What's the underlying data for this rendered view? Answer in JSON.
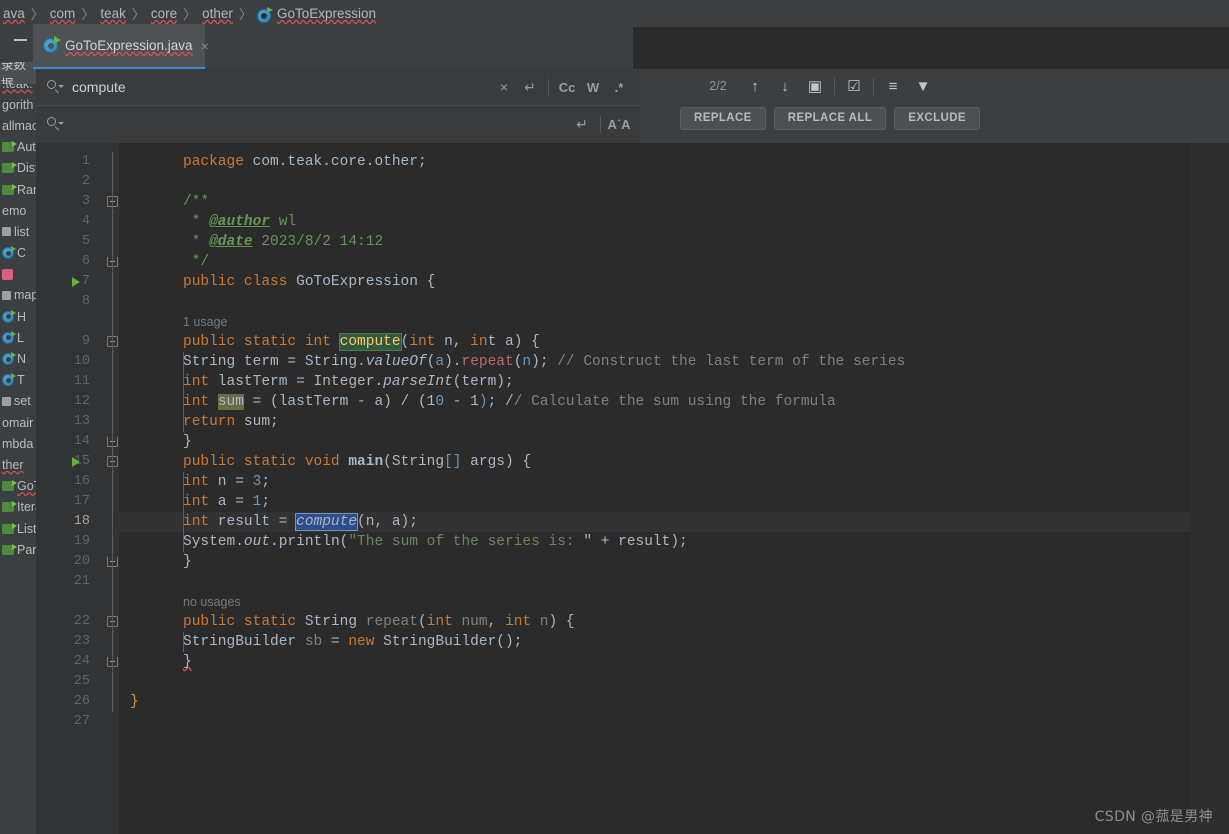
{
  "breadcrumb": {
    "items": [
      "ava",
      "com",
      "teak",
      "core",
      "other"
    ],
    "current_file": "GoToExpression",
    "sep": "〉"
  },
  "window": {
    "minimize_label": "—"
  },
  "tool_tab": {
    "label": "录数据"
  },
  "editor_tab": {
    "label": "GoToExpression.java",
    "close": "×"
  },
  "find": {
    "search_value": "compute",
    "replace_placeholder": "",
    "match_count": "2/2",
    "close_label": "×",
    "newline_label": "↵",
    "match_case": "Cc",
    "words": "W",
    "regex": ".*",
    "preserve_case": "A˙A",
    "prev_label": "↑",
    "next_label": "↓",
    "select_all_label": "▣",
    "in_comments_label": "☑",
    "scope_label": "≡",
    "filter_label": "▼",
    "replace": "REPLACE",
    "replace_all": "REPLACE ALL",
    "exclude": "EXCLUDE"
  },
  "sidebar": {
    "items": [
      {
        "label": ".teak.",
        "icon": "none",
        "squiggle": true
      },
      {
        "label": "gorith",
        "icon": "none",
        "squiggle": false
      },
      {
        "label": "allmac",
        "icon": "none",
        "squiggle": false
      },
      {
        "label": "Autc",
        "icon": "folder-icon",
        "squiggle": false
      },
      {
        "label": "Disti",
        "icon": "folder-icon",
        "squiggle": false
      },
      {
        "label": "Ran",
        "icon": "folder-icon",
        "squiggle": false
      },
      {
        "label": "emo",
        "icon": "none",
        "squiggle": false
      },
      {
        "label": "list",
        "icon": "package-icon",
        "squiggle": false
      },
      {
        "label": "C",
        "icon": "java-class-icon",
        "squiggle": false
      },
      {
        "label": "",
        "icon": "pink-icon",
        "squiggle": false
      },
      {
        "label": "map",
        "icon": "package-icon",
        "squiggle": false
      },
      {
        "label": "H",
        "icon": "java-class-icon",
        "squiggle": false
      },
      {
        "label": "L",
        "icon": "java-class-icon",
        "squiggle": false
      },
      {
        "label": "N",
        "icon": "java-class-icon",
        "squiggle": false
      },
      {
        "label": "T",
        "icon": "java-class-icon",
        "squiggle": false
      },
      {
        "label": "set",
        "icon": "package-icon",
        "squiggle": false
      },
      {
        "label": "omair",
        "icon": "none",
        "squiggle": false
      },
      {
        "label": "mbda",
        "icon": "none",
        "squiggle": false
      },
      {
        "label": "ther",
        "icon": "none",
        "squiggle": true
      },
      {
        "label": "GoT",
        "icon": "folder-icon",
        "squiggle": true
      },
      {
        "label": "Itera",
        "icon": "folder-icon",
        "squiggle": false
      },
      {
        "label": "ListA",
        "icon": "folder-icon",
        "squiggle": false
      },
      {
        "label": "Park",
        "icon": "folder-icon",
        "squiggle": false
      }
    ]
  },
  "editor": {
    "line_numbers": [
      "1",
      "2",
      "3",
      "4",
      "5",
      "6",
      "7",
      "8",
      "9",
      "10",
      "11",
      "12",
      "13",
      "14",
      "15",
      "16",
      "17",
      "18",
      "19",
      "20",
      "21",
      "22",
      "23",
      "24",
      "25",
      "26",
      "27"
    ],
    "current_line": 18,
    "usage_hints": [
      {
        "text": "1 usage",
        "above_line": 9
      },
      {
        "text": "no usages",
        "above_line": 22
      }
    ],
    "code_lines": [
      "package com.teak.core.other;",
      "",
      "/**",
      " * @author wl",
      " * @date 2023/8/2 14:12",
      " */",
      "public class GoToExpression {",
      "",
      "    public static int compute(int n, int a) {",
      "        String term = String.valueOf(a).repeat(n); // Construct the last term of the series",
      "        int lastTerm = Integer.parseInt(term);",
      "        int sum = (lastTerm - a) / (10 - 1); // Calculate the sum using the formula",
      "        return sum;",
      "    }",
      "    public static void main(String[] args) {",
      "        int n = 3;",
      "        int a = 1;",
      "        int result = compute(n, a);",
      "        System.out.println(\"The sum of the series is: \" + result);",
      "    }",
      "",
      "    public static String repeat(int num, int n) {",
      "        StringBuilder sb = new StringBuilder();",
      "    }",
      "",
      "}",
      ""
    ]
  },
  "watermark": {
    "text": "CSDN @菰是男神"
  },
  "colors": {
    "background": "#2b2b2b",
    "panel": "#3c3f41",
    "gutter": "#313335",
    "keyword": "#cc7832",
    "string": "#6a8759",
    "number": "#6897bb",
    "comment": "#808080",
    "javadoc": "#629755",
    "method": "#ffc66d",
    "text": "#a9b7c6",
    "tab_accent": "#4a88c7",
    "match_highlight": "#32593d",
    "selection": "#2f4d8a"
  }
}
